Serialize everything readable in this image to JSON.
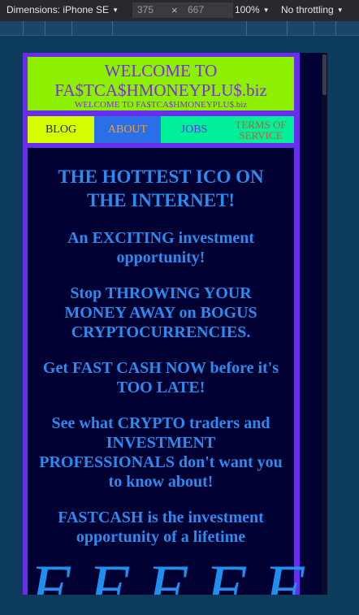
{
  "devtools": {
    "device_label": "Dimensions: iPhone SE",
    "width": "375",
    "height": "667",
    "times": "×",
    "zoom": "100%",
    "throttling": "No throttling"
  },
  "site": {
    "header_title": "WELCOME TO FA$TCA$HMONEYPLU$.biz",
    "header_subtitle": "WELCOME TO FA$TCA$HMONEYPLU$.biz",
    "nav": {
      "blog": "BLOG",
      "about": "ABOUT",
      "jobs": "JOBS",
      "tos": "TERMS OF SERVICE"
    },
    "headline": "THE HOTTEST ICO ON THE INTERNET!",
    "paragraphs": [
      "An EXCITING investment opportunity!",
      "Stop THROWING YOUR MONEY AWAY on BOGUS CRYPTOCURRENCIES.",
      "Get FAST CASH NOW before it's TOO LATE!",
      "See what CRYPTO traders and INVESTMENT PROFESSIONALS don't want you to know about!",
      "FASTCASH is the investment opportunity of a lifetime"
    ],
    "big_letters": [
      "F",
      "F",
      "F",
      "F",
      "F"
    ]
  }
}
